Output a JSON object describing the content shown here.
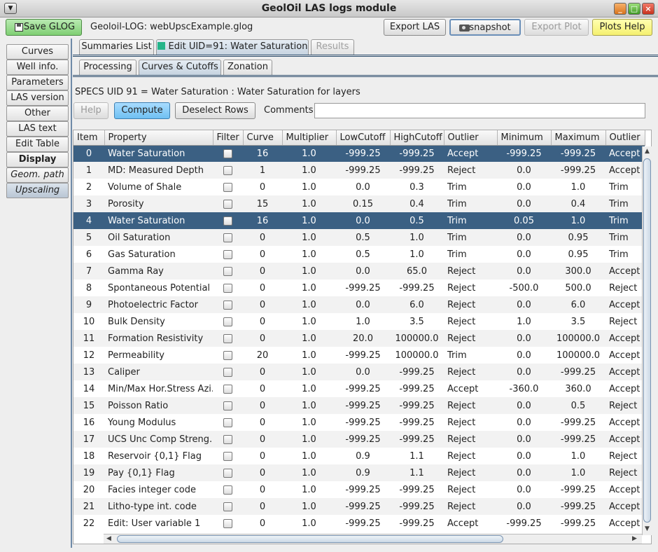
{
  "window": {
    "title": "GeolOil LAS logs module"
  },
  "toolbar": {
    "save_label": "Save GLOG",
    "filename": "Geoloil-LOG: webUpscExample.glog",
    "export_las": "Export LAS",
    "snapshot": "snapshot",
    "export_plot": "Export Plot",
    "plots_help": "Plots Help"
  },
  "sidebar": {
    "items": [
      {
        "label": "Curves"
      },
      {
        "label": "Well info."
      },
      {
        "label": "Parameters"
      },
      {
        "label": "LAS version"
      },
      {
        "label": "Other"
      },
      {
        "label": "LAS text"
      },
      {
        "label": "Edit Table"
      },
      {
        "label": "Display"
      },
      {
        "label": "Geom. path"
      },
      {
        "label": "Upscaling"
      }
    ]
  },
  "tabs_top": {
    "summaries": "Summaries List",
    "edit": "Edit UID=91: Water Saturation",
    "results": "Results"
  },
  "tabs_sub": {
    "processing": "Processing",
    "curves_cutoffs": "Curves & Cutoffs",
    "zonation": "Zonation"
  },
  "specs_text": "SPECS UID 91 = Water Saturation : Water Saturation for layers",
  "actions": {
    "help": "Help",
    "compute": "Compute",
    "deselect": "Deselect Rows",
    "comments_label": "Comments:",
    "comments_value": ""
  },
  "table": {
    "columns": [
      "Item",
      "Property",
      "Filter",
      "Curve",
      "Multiplier",
      "LowCutoff",
      "HighCutoff",
      "Outlier",
      "Minimum",
      "Maximum",
      "Outlier"
    ],
    "rows": [
      [
        "0",
        "Water Saturation",
        "",
        "16",
        "1.0",
        "-999.25",
        "-999.25",
        "Accept",
        "-999.25",
        "-999.25",
        "Accept"
      ],
      [
        "1",
        "MD: Measured Depth",
        "",
        "1",
        "1.0",
        "-999.25",
        "-999.25",
        "Reject",
        "0.0",
        "-999.25",
        "Accept"
      ],
      [
        "2",
        "Volume of Shale",
        "",
        "0",
        "1.0",
        "0.0",
        "0.3",
        "Trim",
        "0.0",
        "1.0",
        "Trim"
      ],
      [
        "3",
        "Porosity",
        "",
        "15",
        "1.0",
        "0.15",
        "0.4",
        "Trim",
        "0.0",
        "0.4",
        "Trim"
      ],
      [
        "4",
        "Water Saturation",
        "",
        "16",
        "1.0",
        "0.0",
        "0.5",
        "Trim",
        "0.05",
        "1.0",
        "Trim"
      ],
      [
        "5",
        "Oil Saturation",
        "",
        "0",
        "1.0",
        "0.5",
        "1.0",
        "Trim",
        "0.0",
        "0.95",
        "Trim"
      ],
      [
        "6",
        "Gas Saturation",
        "",
        "0",
        "1.0",
        "0.5",
        "1.0",
        "Trim",
        "0.0",
        "0.95",
        "Trim"
      ],
      [
        "7",
        "Gamma Ray",
        "",
        "0",
        "1.0",
        "0.0",
        "65.0",
        "Reject",
        "0.0",
        "300.0",
        "Accept"
      ],
      [
        "8",
        "Spontaneous Potential",
        "",
        "0",
        "1.0",
        "-999.25",
        "-999.25",
        "Reject",
        "-500.0",
        "500.0",
        "Reject"
      ],
      [
        "9",
        "Photoelectric Factor",
        "",
        "0",
        "1.0",
        "0.0",
        "6.0",
        "Reject",
        "0.0",
        "6.0",
        "Accept"
      ],
      [
        "10",
        "Bulk Density",
        "",
        "0",
        "1.0",
        "1.0",
        "3.5",
        "Reject",
        "1.0",
        "3.5",
        "Reject"
      ],
      [
        "11",
        "Formation Resistivity",
        "",
        "0",
        "1.0",
        "20.0",
        "100000.0",
        "Reject",
        "0.0",
        "100000.0",
        "Accept"
      ],
      [
        "12",
        "Permeability",
        "",
        "20",
        "1.0",
        "-999.25",
        "100000.0",
        "Trim",
        "0.0",
        "100000.0",
        "Accept"
      ],
      [
        "13",
        "Caliper",
        "",
        "0",
        "1.0",
        "0.0",
        "-999.25",
        "Reject",
        "0.0",
        "-999.25",
        "Accept"
      ],
      [
        "14",
        "Min/Max Hor.Stress Azi.",
        "",
        "0",
        "1.0",
        "-999.25",
        "-999.25",
        "Accept",
        "-360.0",
        "360.0",
        "Accept"
      ],
      [
        "15",
        "Poisson Ratio",
        "",
        "0",
        "1.0",
        "-999.25",
        "-999.25",
        "Reject",
        "0.0",
        "0.5",
        "Reject"
      ],
      [
        "16",
        "Young Modulus",
        "",
        "0",
        "1.0",
        "-999.25",
        "-999.25",
        "Reject",
        "0.0",
        "-999.25",
        "Accept"
      ],
      [
        "17",
        "UCS Unc Comp Streng.",
        "",
        "0",
        "1.0",
        "-999.25",
        "-999.25",
        "Reject",
        "0.0",
        "-999.25",
        "Accept"
      ],
      [
        "18",
        "Reservoir {0,1} Flag",
        "",
        "0",
        "1.0",
        "0.9",
        "1.1",
        "Reject",
        "0.0",
        "1.0",
        "Reject"
      ],
      [
        "19",
        "Pay {0,1} Flag",
        "",
        "0",
        "1.0",
        "0.9",
        "1.1",
        "Reject",
        "0.0",
        "1.0",
        "Reject"
      ],
      [
        "20",
        "Facies integer code",
        "",
        "0",
        "1.0",
        "-999.25",
        "-999.25",
        "Reject",
        "0.0",
        "-999.25",
        "Accept"
      ],
      [
        "21",
        "Litho-type int. code",
        "",
        "0",
        "1.0",
        "-999.25",
        "-999.25",
        "Reject",
        "0.0",
        "-999.25",
        "Accept"
      ],
      [
        "22",
        "Edit: User variable 1",
        "",
        "0",
        "1.0",
        "-999.25",
        "-999.25",
        "Accept",
        "-999.25",
        "-999.25",
        "Accept"
      ]
    ],
    "selected_rows": [
      0,
      4
    ]
  }
}
